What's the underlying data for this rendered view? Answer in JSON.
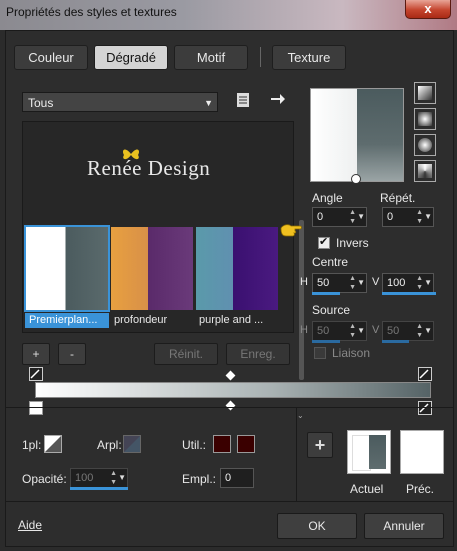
{
  "window": {
    "title": "Propriétés des styles et textures",
    "close_label": "x"
  },
  "tabs": [
    {
      "label": "Couleur",
      "active": false
    },
    {
      "label": "Dégradé",
      "active": true
    },
    {
      "label": "Motif",
      "active": false
    },
    {
      "label": "Texture",
      "active": false
    }
  ],
  "gallery": {
    "category": "Tous",
    "watermark": "Renée Design",
    "items": [
      {
        "label": "Premierplan...",
        "selected": true,
        "colors": [
          "#ffffff",
          "#4b5b5e"
        ]
      },
      {
        "label": "profondeur",
        "selected": false,
        "colors": [
          "#e8a040",
          "#5a2a6a"
        ]
      },
      {
        "label": "purple and ...",
        "selected": false,
        "colors": [
          "#5a9aaa",
          "#3a1070"
        ]
      }
    ],
    "add_label": "+",
    "remove_label": "-",
    "reset_label": "Réinit.",
    "save_label": "Enreg."
  },
  "gradient": {
    "angle_label": "Angle",
    "angle_value": "0",
    "repeat_label": "Répét.",
    "repeat_value": "0",
    "invert_label": "Invers",
    "invert_checked": true,
    "center_label": "Centre",
    "center_h_label": "H",
    "center_h": "50",
    "center_v_label": "V",
    "center_v": "100",
    "source_label": "Source",
    "source_h_label": "H",
    "source_h": "50",
    "source_v_label": "V",
    "source_v": "50",
    "link_label": "Liaison",
    "link_checked": false,
    "bar_colors": [
      "#ffffff",
      "#a9b2b3",
      "#556366"
    ]
  },
  "bottom": {
    "fg_label": "1pl:",
    "arpl_label": "Arpl:",
    "util_label": "Util.:",
    "util_color": "#3a0000",
    "opacity_label": "Opacité:",
    "opacity_value": "100",
    "empl_label": "Empl.:",
    "empl_value": "0",
    "current_label": "Actuel",
    "previous_label": "Préc."
  },
  "footer": {
    "help_label": "Aide",
    "ok_label": "OK",
    "cancel_label": "Annuler"
  },
  "colors": {
    "accent": "#3a93d8",
    "window_bg": "#2d2d2d"
  }
}
